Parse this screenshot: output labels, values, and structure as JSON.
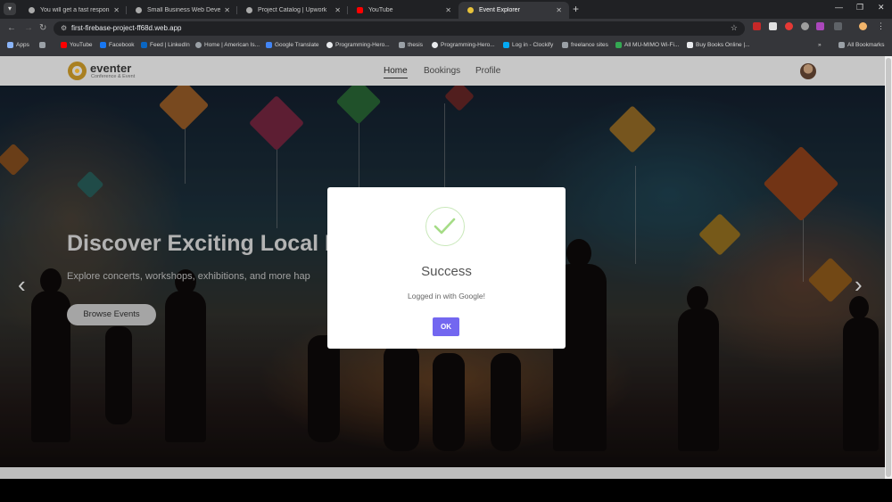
{
  "tabs": [
    {
      "label": "You will get a fast responsive R",
      "color": "#aaaaaa"
    },
    {
      "label": "Small Business Web Develop",
      "color": "#aaaaaa"
    },
    {
      "label": "Project Catalog | Upwork",
      "color": "#aaaaaa"
    },
    {
      "label": "YouTube",
      "color": "#ff0000"
    },
    {
      "label": "Event Explorer",
      "color": "#e8c23a",
      "active": true
    }
  ],
  "address": {
    "url": "first-firebase-project-ff68d.web.app"
  },
  "bookmarks": [
    {
      "label": "Apps",
      "color": "#8ab4f8"
    },
    {
      "label": "YouTube",
      "color": "#ff0000"
    },
    {
      "label": "Facebook",
      "color": "#1877f2"
    },
    {
      "label": "Feed | LinkedIn",
      "color": "#0a66c2"
    },
    {
      "label": "Home | American Is...",
      "color": "#9aa0a6"
    },
    {
      "label": "Google Translate",
      "color": "#4285f4"
    },
    {
      "label": "Programming-Hero...",
      "color": "#e8eaed"
    },
    {
      "label": "thesis",
      "color": "#9aa0a6"
    },
    {
      "label": "Programming-Hero...",
      "color": "#e8eaed"
    },
    {
      "label": "Log in - Clockify",
      "color": "#03a9f4"
    },
    {
      "label": "freelance sites",
      "color": "#9aa0a6"
    },
    {
      "label": "All MU-MIMO Wi-Fi...",
      "color": "#34a853"
    },
    {
      "label": "Buy Books Online |...",
      "color": "#e8eaed"
    }
  ],
  "bookmarks_more": "»",
  "all_bookmarks": "All Bookmarks",
  "site": {
    "logo_name": "eventer",
    "logo_sub": "Conference & Event",
    "nav": [
      "Home",
      "Bookings",
      "Profile"
    ],
    "hero_title": "Discover Exciting Local Ev",
    "hero_subtitle": "Explore concerts, workshops, exhibitions, and more hap",
    "browse_button": "Browse Events",
    "prev_arrow": "‹",
    "next_arrow": "›"
  },
  "dialog": {
    "title": "Success",
    "message": "Logged in with Google!",
    "ok_button": "OK"
  },
  "colors": {
    "accent": "#7367f0",
    "success": "#a5dc86"
  }
}
